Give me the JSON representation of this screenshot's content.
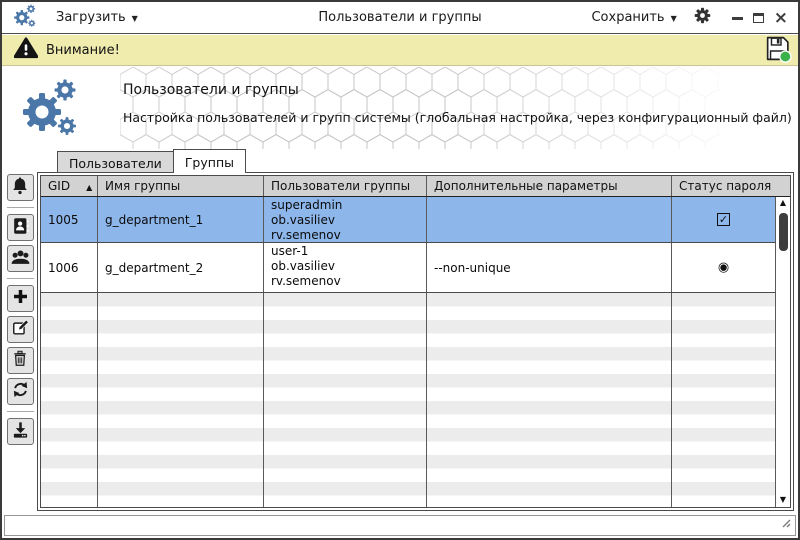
{
  "window": {
    "title": "Пользователи и группы"
  },
  "titlebar": {
    "load_button": "Загрузить",
    "save_button": "Сохранить"
  },
  "warning_bar": {
    "message": "Внимание!"
  },
  "header": {
    "title": "Пользователи и группы",
    "subtitle": "Настройка пользователей и групп системы (глобальная настройка, через конфигурационный файл)"
  },
  "tabs": {
    "users_label": "Пользователи",
    "groups_label": "Группы",
    "active_tab": "Группы"
  },
  "side_toolbar_icons": [
    "notifications-bell",
    "address-book",
    "user-groups",
    "add",
    "edit",
    "delete",
    "refresh",
    "download"
  ],
  "table": {
    "columns": {
      "gid": "GID",
      "name": "Имя группы",
      "users": "Пользователи группы",
      "params": "Дополнительные параметры",
      "status": "Статус пароля"
    },
    "sort": {
      "column": "GID",
      "direction": "asc"
    },
    "rows": [
      {
        "gid": "1005",
        "group_name": "g_department_1",
        "group_users": "superadmin\nob.vasiliev\nrv.semenov",
        "additional_params": "",
        "password_status": "checkbox-checked",
        "selected": true
      },
      {
        "gid": "1006",
        "group_name": "g_department_2",
        "group_users": "user-1\nob.vasiliev\nrv.semenov",
        "additional_params": "--non-unique",
        "password_status": "radio-on",
        "selected": false
      }
    ]
  },
  "icons": {
    "dropdown_arrow": "▼",
    "sort_asc": "▲",
    "scroll_up": "▲",
    "scroll_down": "▼",
    "checkbox_check": "✓",
    "radio_on": "◉",
    "close": "×"
  },
  "colors": {
    "accent_blue": "#4a76a8",
    "warning_bg": "#f0ecae",
    "selected_row": "#8db6ea",
    "table_header": "#d2d2d2",
    "stripe": "#ececec",
    "badge_green": "#3cb24b"
  }
}
